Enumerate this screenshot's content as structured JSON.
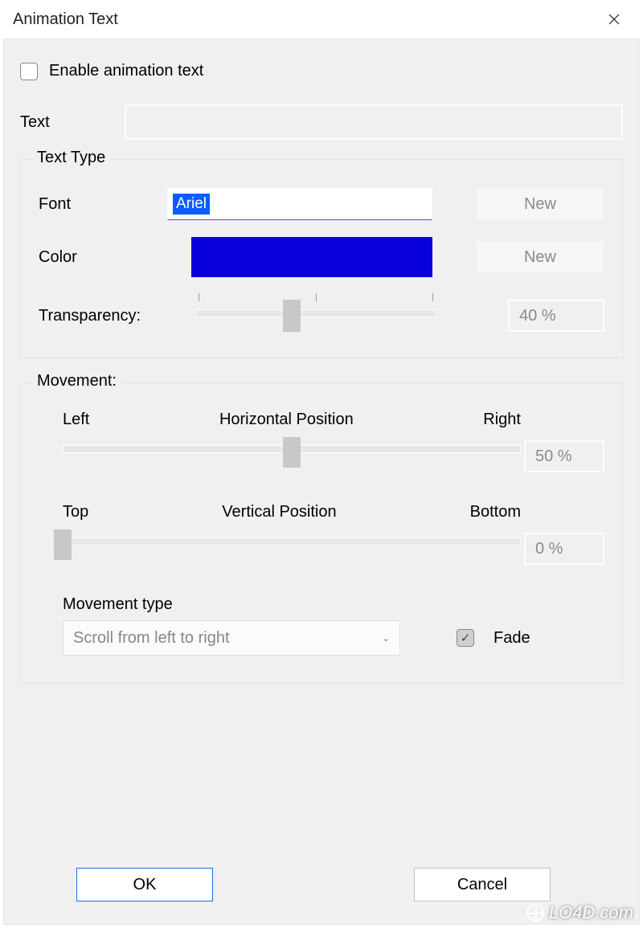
{
  "window": {
    "title": "Animation Text"
  },
  "enable": {
    "label": "Enable animation text",
    "checked": false
  },
  "text": {
    "label": "Text",
    "value": ""
  },
  "textType": {
    "legend": "Text Type",
    "fontLabel": "Font",
    "fontValue": "Ariel",
    "fontNew": "New",
    "colorLabel": "Color",
    "colorValue": "#0a00db",
    "colorNew": "New",
    "transparencyLabel": "Transparency:",
    "transparencyValue": "40 %",
    "transparencyPercent": 40
  },
  "movement": {
    "legend": "Movement:",
    "hLeft": "Left",
    "hTitle": "Horizontal Position",
    "hRight": "Right",
    "hValue": "50 %",
    "hPercent": 50,
    "vTop": "Top",
    "vTitle": "Vertical Position",
    "vBottom": "Bottom",
    "vValue": "0 %",
    "vPercent": 0,
    "typeLabel": "Movement type",
    "typeValue": "Scroll from left to right",
    "fadeLabel": "Fade",
    "fadeChecked": true
  },
  "buttons": {
    "ok": "OK",
    "cancel": "Cancel"
  },
  "watermark": "LO4D.com"
}
